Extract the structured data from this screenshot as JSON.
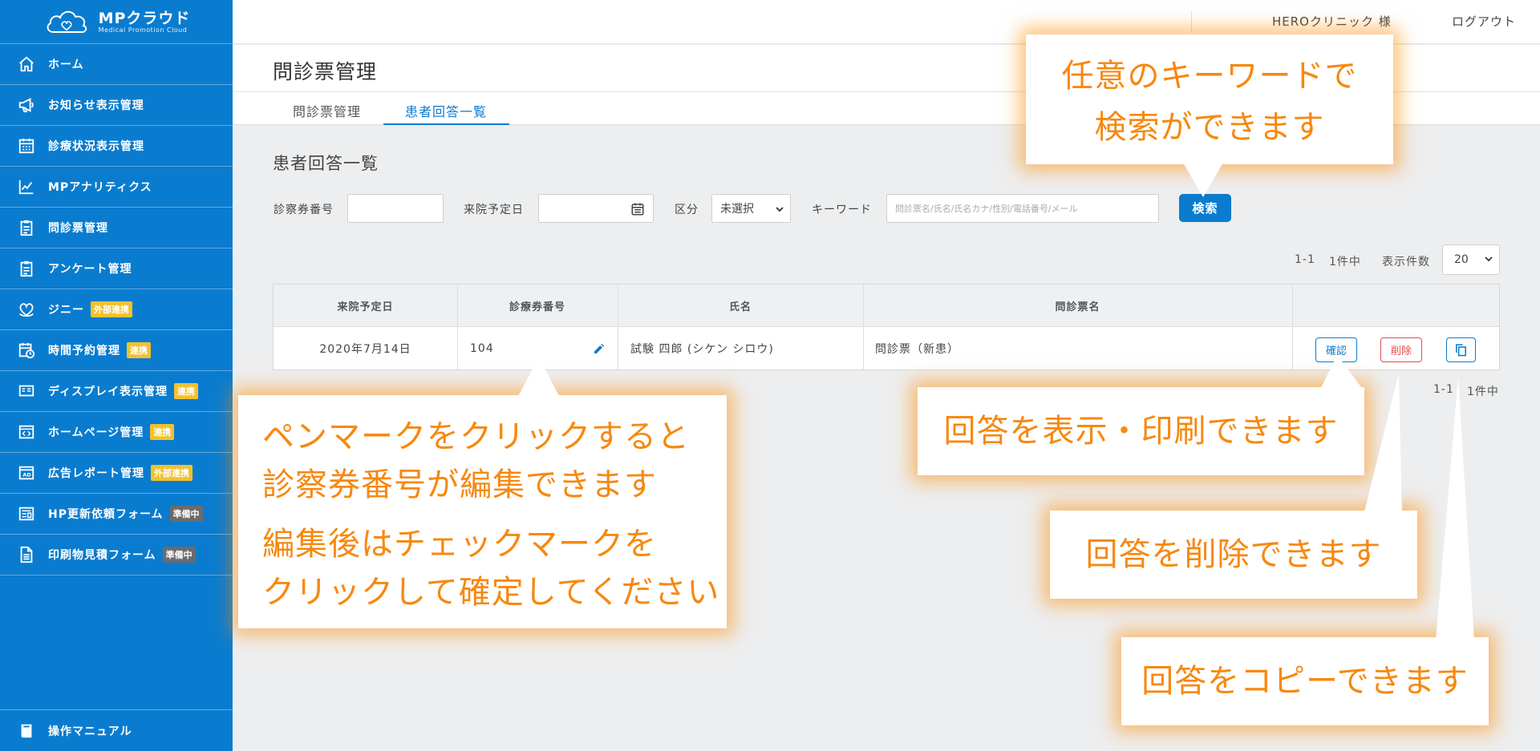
{
  "brand": {
    "title": "MPクラウド",
    "subtitle": "Medical Promotion Cloud"
  },
  "sidebar": {
    "items": [
      {
        "label": "ホーム",
        "icon": "home-icon"
      },
      {
        "label": "お知らせ表示管理",
        "icon": "megaphone-icon"
      },
      {
        "label": "診療状況表示管理",
        "icon": "calendar-grid-icon"
      },
      {
        "label": "MPアナリティクス",
        "icon": "chart-line-icon"
      },
      {
        "label": "問診票管理",
        "icon": "clipboard-icon"
      },
      {
        "label": "アンケート管理",
        "icon": "clipboard-icon"
      },
      {
        "label": "ジニー",
        "icon": "heart-hands-icon",
        "badge": "外部連携",
        "badge_color": "#f2c12e"
      },
      {
        "label": "時間予約管理",
        "icon": "calendar-clock-icon",
        "badge": "連携",
        "badge_color": "#f2c12e"
      },
      {
        "label": "ディスプレイ表示管理",
        "icon": "display-icon",
        "badge": "連携",
        "badge_color": "#f2c12e"
      },
      {
        "label": "ホームページ管理",
        "icon": "code-window-icon",
        "badge": "連携",
        "badge_color": "#f2c12e"
      },
      {
        "label": "広告レポート管理",
        "icon": "ad-icon",
        "badge": "外部連携",
        "badge_color": "#f2c12e"
      },
      {
        "label": "HP更新依頼フォーム",
        "icon": "form-icon",
        "badge": "準備中",
        "badge_color": "#6b6b6b"
      },
      {
        "label": "印刷物見積フォーム",
        "icon": "document-icon",
        "badge": "準備中",
        "badge_color": "#6b6b6b"
      }
    ],
    "footer": {
      "label": "操作マニュアル",
      "icon": "manual-icon"
    }
  },
  "header": {
    "user": "HEROクリニック 様",
    "logout": "ログアウト"
  },
  "page": {
    "title": "問診票管理",
    "tabs": [
      "問診票管理",
      "患者回答一覧"
    ],
    "active_tab": "患者回答一覧",
    "section_title": "患者回答一覧"
  },
  "filters": {
    "card_number_label": "診察券番号",
    "card_number_value": "",
    "visit_date_label": "来院予定日",
    "visit_date_value": "",
    "category_label": "区分",
    "category_value": "未選択",
    "keyword_label": "キーワード",
    "keyword_placeholder": "問診票名/氏名/氏名カナ/性別/電話番号/メール",
    "search_button": "検索"
  },
  "pagination": {
    "range": "1-1",
    "total": "1件中",
    "per_page_label": "表示件数",
    "per_page_value": "20"
  },
  "table": {
    "headers": [
      "来院予定日",
      "診療券番号",
      "氏名",
      "問診票名",
      ""
    ],
    "rows": [
      {
        "date": "2020年7月14日",
        "card_no": "104",
        "name": "試験 四郎 (シケン シロウ)",
        "questionnaire": "問診票（新患）",
        "confirm": "確認",
        "delete": "削除"
      }
    ]
  },
  "colors": {
    "primary": "#0a7ccf",
    "danger": "#e84a4a",
    "callout_text": "#f7880f",
    "badge_yellow": "#f2c12e",
    "badge_gray": "#6b6b6b"
  },
  "callouts": {
    "keyword": [
      "任意のキーワードで",
      "検索ができます"
    ],
    "pen": [
      "ペンマークをクリックすると",
      "診察券番号が編集できます",
      "編集後はチェックマークを",
      "クリックして確定してください"
    ],
    "view": "回答を表示・印刷できます",
    "delete": "回答を削除できます",
    "copy": "回答をコピーできます"
  }
}
